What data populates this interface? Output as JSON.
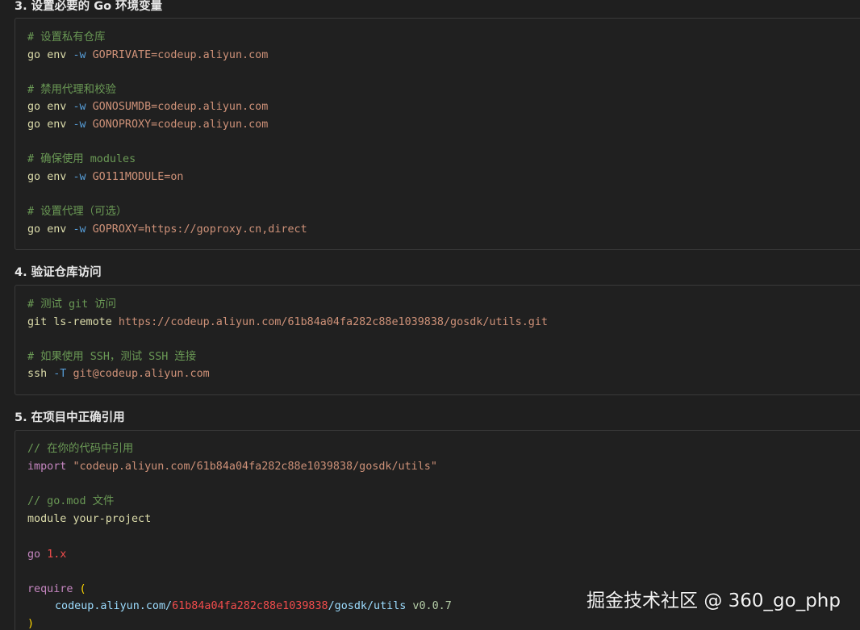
{
  "sections": [
    {
      "heading": "3. 设置必要的 Go 环境变量",
      "lines": [
        {
          "kind": "comment",
          "text": "# 设置私有仓库"
        },
        {
          "kind": "cmd",
          "cmd": "go",
          "sub": "env",
          "flag": "-w",
          "arg": "GOPRIVATE=codeup.aliyun.com"
        },
        {
          "kind": "blank"
        },
        {
          "kind": "comment",
          "text": "# 禁用代理和校验"
        },
        {
          "kind": "cmd",
          "cmd": "go",
          "sub": "env",
          "flag": "-w",
          "arg": "GONOSUMDB=codeup.aliyun.com"
        },
        {
          "kind": "cmd",
          "cmd": "go",
          "sub": "env",
          "flag": "-w",
          "arg": "GONOPROXY=codeup.aliyun.com"
        },
        {
          "kind": "blank"
        },
        {
          "kind": "comment",
          "text": "# 确保使用 modules"
        },
        {
          "kind": "cmd",
          "cmd": "go",
          "sub": "env",
          "flag": "-w",
          "arg": "GO111MODULE=on"
        },
        {
          "kind": "blank"
        },
        {
          "kind": "comment",
          "text": "# 设置代理（可选）"
        },
        {
          "kind": "cmd",
          "cmd": "go",
          "sub": "env",
          "flag": "-w",
          "arg": "GOPROXY=https://goproxy.cn,direct"
        }
      ]
    },
    {
      "heading": "4. 验证仓库访问",
      "lines": [
        {
          "kind": "comment",
          "text": "# 测试 git 访问"
        },
        {
          "kind": "cmd2",
          "cmd": "git",
          "sub": "ls-remote",
          "arg": "https://codeup.aliyun.com/61b84a04fa282c88e1039838/gosdk/utils.git"
        },
        {
          "kind": "blank"
        },
        {
          "kind": "comment",
          "text": "# 如果使用 SSH，测试 SSH 连接"
        },
        {
          "kind": "cmd",
          "cmd": "ssh",
          "sub": "",
          "flag": "-T",
          "arg": "git@codeup.aliyun.com"
        }
      ]
    },
    {
      "heading": "5. 在项目中正确引用",
      "lines": [
        {
          "kind": "comment",
          "text": "// 在你的代码中引用"
        },
        {
          "kind": "import",
          "kw": "import",
          "str": "\"codeup.aliyun.com/61b84a04fa282c88e1039838/gosdk/utils\""
        },
        {
          "kind": "blank"
        },
        {
          "kind": "comment",
          "text": "// go.mod 文件"
        },
        {
          "kind": "module",
          "kw": "module",
          "name": "your-project"
        },
        {
          "kind": "blank"
        },
        {
          "kind": "gover",
          "kw": "go",
          "ver": "1.x"
        },
        {
          "kind": "blank"
        },
        {
          "kind": "require",
          "kw": "require",
          "paren": "("
        },
        {
          "kind": "dep",
          "p1": "codeup.aliyun.com/",
          "p2": "61b84a04fa282c88e1039838",
          "p3": "/gosdk/utils",
          "ver": "v0.0.7"
        },
        {
          "kind": "close",
          "paren": ")"
        }
      ]
    }
  ],
  "watermark": "掘金技术社区 @ 360_go_php"
}
